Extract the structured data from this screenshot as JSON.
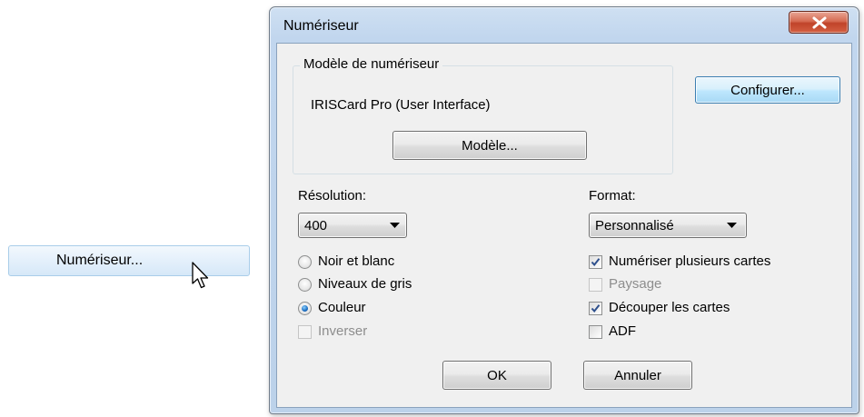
{
  "menu": {
    "item_label": "Numériseur..."
  },
  "dialog": {
    "title": "Numériseur",
    "scanner_model_group_label": "Modèle de numériseur",
    "scanner_model_name": "IRISCard Pro (User Interface)",
    "model_button_label": "Modèle...",
    "configure_button_label": "Configurer...",
    "resolution_label": "Résolution:",
    "resolution_value": "400",
    "format_label": "Format:",
    "format_value": "Personnalisé",
    "color_modes": [
      {
        "label": "Noir et blanc",
        "selected": false
      },
      {
        "label": "Niveaux de gris",
        "selected": false
      },
      {
        "label": "Couleur",
        "selected": true
      }
    ],
    "invert_label": "Inverser",
    "options": [
      {
        "label": "Numériser plusieurs cartes",
        "checked": true,
        "enabled": true
      },
      {
        "label": "Paysage",
        "checked": false,
        "enabled": false
      },
      {
        "label": "Découper les cartes",
        "checked": true,
        "enabled": true
      },
      {
        "label": "ADF",
        "checked": false,
        "enabled": true
      }
    ],
    "ok_label": "OK",
    "cancel_label": "Annuler"
  },
  "icons": {
    "close": "close-icon",
    "dropdown": "chevron-down-icon",
    "cursor": "mouse-pointer-icon",
    "check": "checkmark-icon"
  },
  "colors": {
    "close_button": "#c8472c",
    "default_button_border": "#3c7fb1",
    "menu_highlight": "#dcecf9",
    "window_frame": "#c1d6ee",
    "dialog_background": "#f0f0f0"
  }
}
